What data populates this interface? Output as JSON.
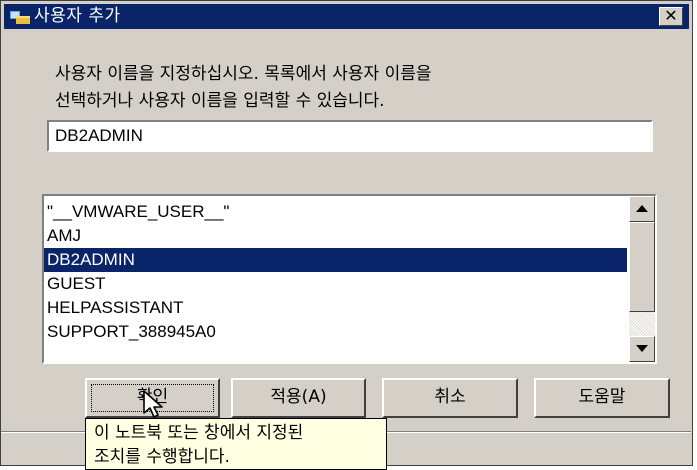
{
  "window": {
    "title": "사용자 추가",
    "close_label": "✕"
  },
  "instruction": {
    "line1": "사용자 이름을 지정하십시오. 목록에서 사용자 이름을",
    "line2": "선택하거나 사용자 이름을 입력할 수 있습니다."
  },
  "name_input": {
    "value": "DB2ADMIN"
  },
  "user_list": {
    "items": [
      "\"__VMWARE_USER__\"",
      "AMJ",
      "DB2ADMIN",
      "GUEST",
      "HELPASSISTANT",
      "SUPPORT_388945A0"
    ],
    "selected": "DB2ADMIN"
  },
  "buttons": {
    "ok": "확인",
    "apply": "적용(A)",
    "cancel": "취소",
    "help": "도움말"
  },
  "tooltip": {
    "line1": "이 노트북 또는 창에서 지정된",
    "line2": "조치를 수행합니다."
  },
  "colors": {
    "titlebar": "#0a246a",
    "selection": "#0a246a",
    "dialog_face": "#d4d0c8",
    "tooltip_bg": "#ffffe1"
  }
}
